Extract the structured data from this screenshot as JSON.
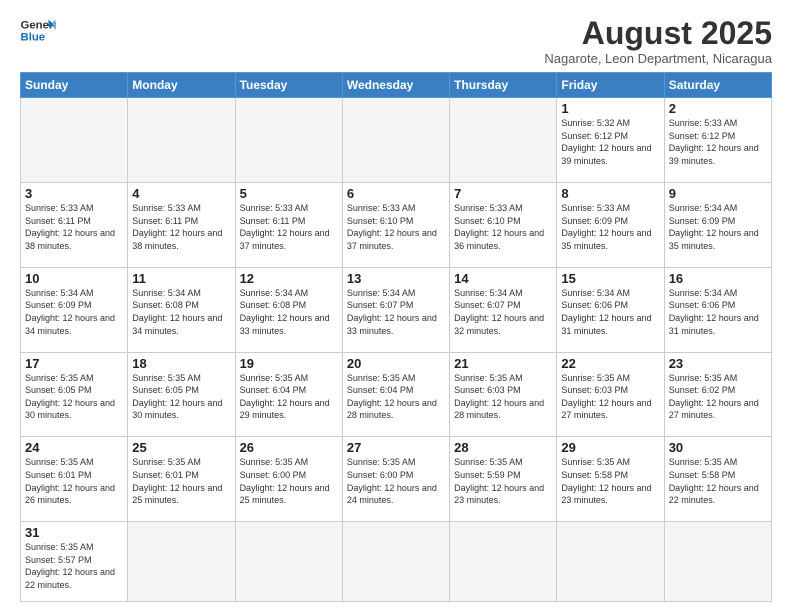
{
  "header": {
    "logo_general": "General",
    "logo_blue": "Blue",
    "month_year": "August 2025",
    "location": "Nagarote, Leon Department, Nicaragua"
  },
  "weekdays": [
    "Sunday",
    "Monday",
    "Tuesday",
    "Wednesday",
    "Thursday",
    "Friday",
    "Saturday"
  ],
  "weeks": [
    [
      {
        "day": "",
        "info": "",
        "empty": true
      },
      {
        "day": "",
        "info": "",
        "empty": true
      },
      {
        "day": "",
        "info": "",
        "empty": true
      },
      {
        "day": "",
        "info": "",
        "empty": true
      },
      {
        "day": "",
        "info": "",
        "empty": true
      },
      {
        "day": "1",
        "info": "Sunrise: 5:32 AM\nSunset: 6:12 PM\nDaylight: 12 hours\nand 39 minutes."
      },
      {
        "day": "2",
        "info": "Sunrise: 5:33 AM\nSunset: 6:12 PM\nDaylight: 12 hours\nand 39 minutes."
      }
    ],
    [
      {
        "day": "3",
        "info": "Sunrise: 5:33 AM\nSunset: 6:11 PM\nDaylight: 12 hours\nand 38 minutes."
      },
      {
        "day": "4",
        "info": "Sunrise: 5:33 AM\nSunset: 6:11 PM\nDaylight: 12 hours\nand 38 minutes."
      },
      {
        "day": "5",
        "info": "Sunrise: 5:33 AM\nSunset: 6:11 PM\nDaylight: 12 hours\nand 37 minutes."
      },
      {
        "day": "6",
        "info": "Sunrise: 5:33 AM\nSunset: 6:10 PM\nDaylight: 12 hours\nand 37 minutes."
      },
      {
        "day": "7",
        "info": "Sunrise: 5:33 AM\nSunset: 6:10 PM\nDaylight: 12 hours\nand 36 minutes."
      },
      {
        "day": "8",
        "info": "Sunrise: 5:33 AM\nSunset: 6:09 PM\nDaylight: 12 hours\nand 35 minutes."
      },
      {
        "day": "9",
        "info": "Sunrise: 5:34 AM\nSunset: 6:09 PM\nDaylight: 12 hours\nand 35 minutes."
      }
    ],
    [
      {
        "day": "10",
        "info": "Sunrise: 5:34 AM\nSunset: 6:09 PM\nDaylight: 12 hours\nand 34 minutes."
      },
      {
        "day": "11",
        "info": "Sunrise: 5:34 AM\nSunset: 6:08 PM\nDaylight: 12 hours\nand 34 minutes."
      },
      {
        "day": "12",
        "info": "Sunrise: 5:34 AM\nSunset: 6:08 PM\nDaylight: 12 hours\nand 33 minutes."
      },
      {
        "day": "13",
        "info": "Sunrise: 5:34 AM\nSunset: 6:07 PM\nDaylight: 12 hours\nand 33 minutes."
      },
      {
        "day": "14",
        "info": "Sunrise: 5:34 AM\nSunset: 6:07 PM\nDaylight: 12 hours\nand 32 minutes."
      },
      {
        "day": "15",
        "info": "Sunrise: 5:34 AM\nSunset: 6:06 PM\nDaylight: 12 hours\nand 31 minutes."
      },
      {
        "day": "16",
        "info": "Sunrise: 5:34 AM\nSunset: 6:06 PM\nDaylight: 12 hours\nand 31 minutes."
      }
    ],
    [
      {
        "day": "17",
        "info": "Sunrise: 5:35 AM\nSunset: 6:05 PM\nDaylight: 12 hours\nand 30 minutes."
      },
      {
        "day": "18",
        "info": "Sunrise: 5:35 AM\nSunset: 6:05 PM\nDaylight: 12 hours\nand 30 minutes."
      },
      {
        "day": "19",
        "info": "Sunrise: 5:35 AM\nSunset: 6:04 PM\nDaylight: 12 hours\nand 29 minutes."
      },
      {
        "day": "20",
        "info": "Sunrise: 5:35 AM\nSunset: 6:04 PM\nDaylight: 12 hours\nand 28 minutes."
      },
      {
        "day": "21",
        "info": "Sunrise: 5:35 AM\nSunset: 6:03 PM\nDaylight: 12 hours\nand 28 minutes."
      },
      {
        "day": "22",
        "info": "Sunrise: 5:35 AM\nSunset: 6:03 PM\nDaylight: 12 hours\nand 27 minutes."
      },
      {
        "day": "23",
        "info": "Sunrise: 5:35 AM\nSunset: 6:02 PM\nDaylight: 12 hours\nand 27 minutes."
      }
    ],
    [
      {
        "day": "24",
        "info": "Sunrise: 5:35 AM\nSunset: 6:01 PM\nDaylight: 12 hours\nand 26 minutes."
      },
      {
        "day": "25",
        "info": "Sunrise: 5:35 AM\nSunset: 6:01 PM\nDaylight: 12 hours\nand 25 minutes."
      },
      {
        "day": "26",
        "info": "Sunrise: 5:35 AM\nSunset: 6:00 PM\nDaylight: 12 hours\nand 25 minutes."
      },
      {
        "day": "27",
        "info": "Sunrise: 5:35 AM\nSunset: 6:00 PM\nDaylight: 12 hours\nand 24 minutes."
      },
      {
        "day": "28",
        "info": "Sunrise: 5:35 AM\nSunset: 5:59 PM\nDaylight: 12 hours\nand 23 minutes."
      },
      {
        "day": "29",
        "info": "Sunrise: 5:35 AM\nSunset: 5:58 PM\nDaylight: 12 hours\nand 23 minutes."
      },
      {
        "day": "30",
        "info": "Sunrise: 5:35 AM\nSunset: 5:58 PM\nDaylight: 12 hours\nand 22 minutes."
      }
    ],
    [
      {
        "day": "31",
        "info": "Sunrise: 5:35 AM\nSunset: 5:57 PM\nDaylight: 12 hours\nand 22 minutes."
      },
      {
        "day": "",
        "info": "",
        "empty": true
      },
      {
        "day": "",
        "info": "",
        "empty": true
      },
      {
        "day": "",
        "info": "",
        "empty": true
      },
      {
        "day": "",
        "info": "",
        "empty": true
      },
      {
        "day": "",
        "info": "",
        "empty": true
      },
      {
        "day": "",
        "info": "",
        "empty": true
      }
    ]
  ]
}
